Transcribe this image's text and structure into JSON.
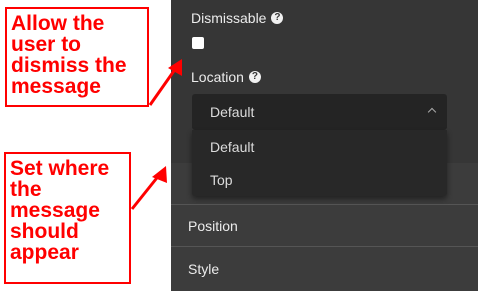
{
  "panel": {
    "dismissable": {
      "label": "Dismissable",
      "help_icon": "?",
      "checked": false
    },
    "location": {
      "label": "Location",
      "help_icon": "?",
      "selected": "Default",
      "options": [
        "Default",
        "Top"
      ],
      "expanded": true
    },
    "sections": [
      "Position",
      "Style"
    ]
  },
  "callouts": {
    "dismiss": [
      "Allow the",
      "user to",
      "dismiss the",
      "message"
    ],
    "location": [
      "Set where",
      "the",
      "message",
      "should",
      "appear"
    ]
  },
  "colors": {
    "annotation": "#ff0000",
    "panel_bg": "#363636",
    "text": "#ececec"
  },
  "icons": {
    "help": "help-circle-icon",
    "dropdown": "chevron-up-icon"
  }
}
